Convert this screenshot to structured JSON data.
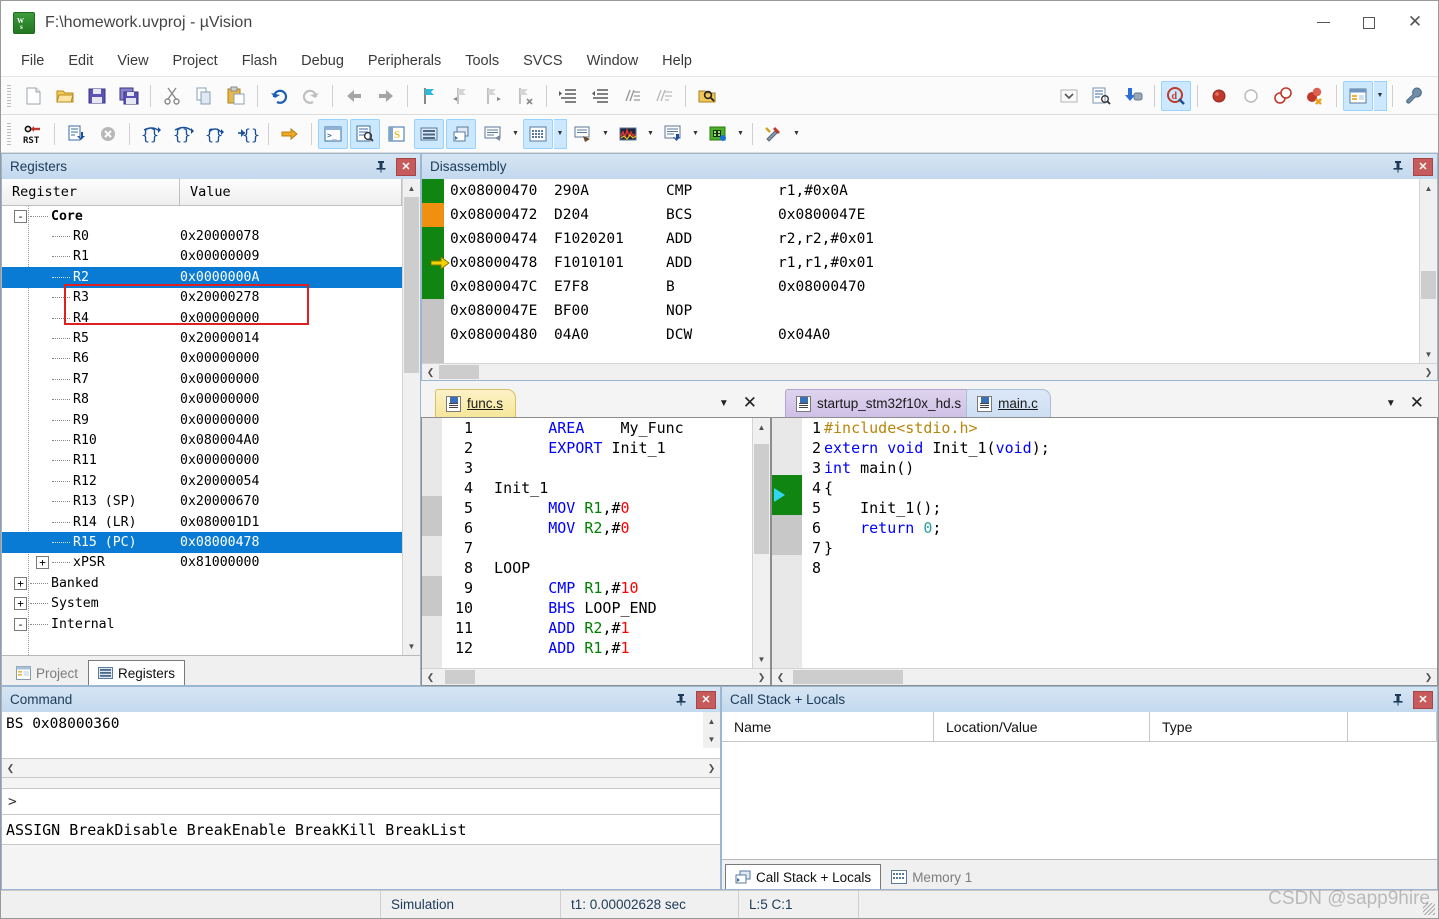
{
  "window": {
    "title": "F:\\homework.uvproj - µVision",
    "app_icon": "uvision-icon",
    "minimize_label": "Minimize",
    "maximize_label": "Maximize",
    "close_label": "Close"
  },
  "menubar": {
    "items": [
      {
        "label": "File"
      },
      {
        "label": "Edit"
      },
      {
        "label": "View"
      },
      {
        "label": "Project"
      },
      {
        "label": "Flash"
      },
      {
        "label": "Debug"
      },
      {
        "label": "Peripherals"
      },
      {
        "label": "Tools"
      },
      {
        "label": "SVCS"
      },
      {
        "label": "Window"
      },
      {
        "label": "Help"
      }
    ]
  },
  "toolbar_main": {
    "items": [
      {
        "icon": "new-file-icon",
        "name": "new-file"
      },
      {
        "icon": "open-folder-icon",
        "name": "open-file"
      },
      {
        "icon": "save-icon",
        "name": "save"
      },
      {
        "icon": "save-all-icon",
        "name": "save-all"
      },
      {
        "sep": true
      },
      {
        "icon": "cut-icon",
        "name": "cut"
      },
      {
        "icon": "copy-icon",
        "name": "copy"
      },
      {
        "icon": "paste-icon",
        "name": "paste"
      },
      {
        "sep": true
      },
      {
        "icon": "undo-icon",
        "name": "undo"
      },
      {
        "icon": "redo-icon",
        "name": "redo"
      },
      {
        "sep": true
      },
      {
        "icon": "back-arrow-icon",
        "name": "navigate-back"
      },
      {
        "icon": "forward-arrow-icon",
        "name": "navigate-forward"
      },
      {
        "sep": true
      },
      {
        "icon": "bookmark-icon",
        "name": "toggle-bookmark"
      },
      {
        "icon": "bookmark-prev-icon",
        "name": "previous-bookmark"
      },
      {
        "icon": "bookmark-next-icon",
        "name": "next-bookmark"
      },
      {
        "icon": "bookmark-clear-icon",
        "name": "clear-bookmarks"
      },
      {
        "sep": true
      },
      {
        "icon": "indent-right-icon",
        "name": "indent-right"
      },
      {
        "icon": "indent-left-icon",
        "name": "indent-left"
      },
      {
        "icon": "comment-icon",
        "name": "comment-selection"
      },
      {
        "icon": "uncomment-icon",
        "name": "uncomment-selection"
      },
      {
        "sep": true
      },
      {
        "icon": "find-in-files-icon",
        "name": "find-in-files"
      }
    ],
    "right_items": [
      {
        "icon": "chevron-down-icon",
        "name": "toolbar-overflow"
      },
      {
        "icon": "configure-icon",
        "name": "configure-target"
      },
      {
        "icon": "download-icon",
        "name": "download-to-flash"
      },
      {
        "sep": true
      },
      {
        "icon": "debug-session-icon",
        "name": "start-stop-debug-session",
        "active": true
      },
      {
        "sep": true
      },
      {
        "icon": "breakpoint-icon",
        "name": "insert-remove-breakpoint"
      },
      {
        "icon": "breakpoint-disable-icon",
        "name": "enable-disable-breakpoint"
      },
      {
        "icon": "breakpoint-disable-all-icon",
        "name": "disable-all-breakpoints"
      },
      {
        "icon": "breakpoint-kill-all-icon",
        "name": "kill-all-breakpoints"
      },
      {
        "sep": true
      },
      {
        "icon": "project-window-icon",
        "name": "project-windows",
        "active": true,
        "caret": true
      },
      {
        "sep": true
      },
      {
        "icon": "wrench-icon",
        "name": "configuration-wizard"
      }
    ]
  },
  "toolbar_debug": {
    "items": [
      {
        "icon": "reset-icon",
        "name": "reset-cpu",
        "label": "RST"
      },
      {
        "sep": true
      },
      {
        "icon": "run-icon",
        "name": "run"
      },
      {
        "icon": "stop-icon",
        "name": "stop"
      },
      {
        "sep": true
      },
      {
        "icon": "step-into-icon",
        "name": "step"
      },
      {
        "icon": "step-over-icon",
        "name": "step-over"
      },
      {
        "icon": "step-out-icon",
        "name": "step-out"
      },
      {
        "icon": "run-to-cursor-icon",
        "name": "run-to-cursor-line"
      },
      {
        "sep": true
      },
      {
        "icon": "show-next-statement-icon",
        "name": "show-next-statement"
      },
      {
        "sep": true
      },
      {
        "icon": "command-window-icon",
        "name": "command-window",
        "active": true
      },
      {
        "icon": "disassembly-window-icon",
        "name": "disassembly-window",
        "active": true
      },
      {
        "icon": "symbols-window-icon",
        "name": "symbol-window"
      },
      {
        "icon": "registers-window-icon",
        "name": "registers-window",
        "active": true
      },
      {
        "icon": "call-stack-icon",
        "name": "call-stack-window",
        "active": true
      },
      {
        "icon": "watch-window-icon",
        "name": "watch-windows",
        "caret": true
      },
      {
        "icon": "memory-window-icon",
        "name": "memory-windows",
        "active": true,
        "caret": true
      },
      {
        "icon": "serial-window-icon",
        "name": "serial-windows",
        "caret": true
      },
      {
        "icon": "analysis-window-icon",
        "name": "analysis-windows",
        "caret": true
      },
      {
        "icon": "trace-window-icon",
        "name": "trace-windows",
        "caret": true
      },
      {
        "icon": "system-viewer-icon",
        "name": "system-analyzer",
        "caret": true
      },
      {
        "sep": true
      },
      {
        "icon": "tools-icon",
        "name": "debug-tools",
        "caret": true
      }
    ]
  },
  "registers_panel": {
    "title": "Registers",
    "pin_icon": "pin-icon",
    "close_icon": "close-icon",
    "columns": [
      "Register",
      "Value"
    ],
    "rows": [
      {
        "name": "Core",
        "value": "",
        "depth": 0,
        "expander": "-",
        "bold": true,
        "selected": false
      },
      {
        "name": "R0",
        "value": "0x20000078",
        "depth": 1,
        "expander": "",
        "bold": false,
        "selected": false
      },
      {
        "name": "R1",
        "value": "0x00000009",
        "depth": 1,
        "expander": "",
        "bold": false,
        "selected": false
      },
      {
        "name": "R2",
        "value": "0x0000000A",
        "depth": 1,
        "expander": "",
        "bold": false,
        "selected": true
      },
      {
        "name": "R3",
        "value": "0x20000278",
        "depth": 1,
        "expander": "",
        "bold": false,
        "selected": false
      },
      {
        "name": "R4",
        "value": "0x00000000",
        "depth": 1,
        "expander": "",
        "bold": false,
        "selected": false
      },
      {
        "name": "R5",
        "value": "0x20000014",
        "depth": 1,
        "expander": "",
        "bold": false,
        "selected": false
      },
      {
        "name": "R6",
        "value": "0x00000000",
        "depth": 1,
        "expander": "",
        "bold": false,
        "selected": false
      },
      {
        "name": "R7",
        "value": "0x00000000",
        "depth": 1,
        "expander": "",
        "bold": false,
        "selected": false
      },
      {
        "name": "R8",
        "value": "0x00000000",
        "depth": 1,
        "expander": "",
        "bold": false,
        "selected": false
      },
      {
        "name": "R9",
        "value": "0x00000000",
        "depth": 1,
        "expander": "",
        "bold": false,
        "selected": false
      },
      {
        "name": "R10",
        "value": "0x080004A0",
        "depth": 1,
        "expander": "",
        "bold": false,
        "selected": false
      },
      {
        "name": "R11",
        "value": "0x00000000",
        "depth": 1,
        "expander": "",
        "bold": false,
        "selected": false
      },
      {
        "name": "R12",
        "value": "0x20000054",
        "depth": 1,
        "expander": "",
        "bold": false,
        "selected": false
      },
      {
        "name": "R13 (SP)",
        "value": "0x20000670",
        "depth": 1,
        "expander": "",
        "bold": false,
        "selected": false
      },
      {
        "name": "R14 (LR)",
        "value": "0x080001D1",
        "depth": 1,
        "expander": "",
        "bold": false,
        "selected": false
      },
      {
        "name": "R15 (PC)",
        "value": "0x08000478",
        "depth": 1,
        "expander": "",
        "bold": false,
        "selected": true
      },
      {
        "name": "xPSR",
        "value": "0x81000000",
        "depth": 1,
        "expander": "+",
        "bold": false,
        "selected": false
      },
      {
        "name": "Banked",
        "value": "",
        "depth": 0,
        "expander": "+",
        "bold": false,
        "selected": false
      },
      {
        "name": "System",
        "value": "",
        "depth": 0,
        "expander": "+",
        "bold": false,
        "selected": false
      },
      {
        "name": "Internal",
        "value": "",
        "depth": 0,
        "expander": "-",
        "bold": false,
        "selected": false
      }
    ],
    "highlight_annotation": "red-rectangle-around-R1-R2",
    "dock_tabs": [
      {
        "label": "Project",
        "icon": "project-icon",
        "active": false
      },
      {
        "label": "Registers",
        "icon": "registers-icon",
        "active": true
      }
    ]
  },
  "disassembly_panel": {
    "title": "Disassembly",
    "pin_icon": "pin-icon",
    "close_icon": "close-icon",
    "lines": [
      {
        "address": "0x08000470",
        "opcode": "290A",
        "mnemonic": "CMP",
        "operands": "r1,#0x0A",
        "marker": "green",
        "current": false
      },
      {
        "address": "0x08000472",
        "opcode": "D204",
        "mnemonic": "BCS",
        "operands": "0x0800047E",
        "marker": "orange",
        "current": false
      },
      {
        "address": "0x08000474",
        "opcode": "F1020201",
        "mnemonic": "ADD",
        "operands": "r2,r2,#0x01",
        "marker": "green",
        "current": false
      },
      {
        "address": "0x08000478",
        "opcode": "F1010101",
        "mnemonic": "ADD",
        "operands": "r1,r1,#0x01",
        "marker": "green",
        "current": true
      },
      {
        "address": "0x0800047C",
        "opcode": "E7F8",
        "mnemonic": "B",
        "operands": "0x08000470",
        "marker": "green",
        "current": false
      },
      {
        "address": "0x0800047E",
        "opcode": "BF00",
        "mnemonic": "NOP",
        "operands": "",
        "marker": "grey",
        "current": false
      },
      {
        "address": "0x08000480",
        "opcode": "04A0",
        "mnemonic": "DCW",
        "operands": "0x04A0",
        "marker": "grey",
        "current": false
      }
    ]
  },
  "editor_left": {
    "tabs": [
      {
        "label": "func.s",
        "active": true,
        "color": "yellow",
        "icon": "asm-file-icon"
      }
    ],
    "caret_icon": "chevron-down-icon",
    "close_icon": "close-icon",
    "lines": [
      {
        "n": "1",
        "tokens": [
          {
            "t": "        ",
            "c": ""
          },
          {
            "t": "AREA",
            "c": "kw"
          },
          {
            "t": "    ",
            "c": ""
          },
          {
            "t": "My_Func",
            "c": ""
          }
        ]
      },
      {
        "n": "2",
        "tokens": [
          {
            "t": "        ",
            "c": ""
          },
          {
            "t": "EXPORT",
            "c": "kw"
          },
          {
            "t": " Init_1",
            "c": ""
          }
        ]
      },
      {
        "n": "3",
        "tokens": [
          {
            "t": "",
            "c": ""
          }
        ]
      },
      {
        "n": "4",
        "tokens": [
          {
            "t": "  Init_1",
            "c": ""
          }
        ]
      },
      {
        "n": "5",
        "tokens": [
          {
            "t": "        ",
            "c": ""
          },
          {
            "t": "MOV",
            "c": "kw"
          },
          {
            "t": " ",
            "c": ""
          },
          {
            "t": "R1",
            "c": "reg"
          },
          {
            "t": ",#",
            "c": ""
          },
          {
            "t": "0",
            "c": "num"
          }
        ]
      },
      {
        "n": "6",
        "tokens": [
          {
            "t": "        ",
            "c": ""
          },
          {
            "t": "MOV",
            "c": "kw"
          },
          {
            "t": " ",
            "c": ""
          },
          {
            "t": "R2",
            "c": "reg"
          },
          {
            "t": ",#",
            "c": ""
          },
          {
            "t": "0",
            "c": "num"
          }
        ]
      },
      {
        "n": "7",
        "tokens": [
          {
            "t": "",
            "c": ""
          }
        ]
      },
      {
        "n": "8",
        "tokens": [
          {
            "t": "  LOOP",
            "c": ""
          }
        ]
      },
      {
        "n": "9",
        "tokens": [
          {
            "t": "        ",
            "c": ""
          },
          {
            "t": "CMP",
            "c": "kw"
          },
          {
            "t": " ",
            "c": ""
          },
          {
            "t": "R1",
            "c": "reg"
          },
          {
            "t": ",#",
            "c": ""
          },
          {
            "t": "10",
            "c": "num"
          }
        ]
      },
      {
        "n": "10",
        "tokens": [
          {
            "t": "        ",
            "c": ""
          },
          {
            "t": "BHS",
            "c": "kw"
          },
          {
            "t": " LOOP_END",
            "c": ""
          }
        ]
      },
      {
        "n": "11",
        "tokens": [
          {
            "t": "        ",
            "c": ""
          },
          {
            "t": "ADD",
            "c": "kw"
          },
          {
            "t": " ",
            "c": ""
          },
          {
            "t": "R2",
            "c": "reg"
          },
          {
            "t": ",#",
            "c": ""
          },
          {
            "t": "1",
            "c": "num"
          }
        ]
      },
      {
        "n": "12",
        "tokens": [
          {
            "t": "        ",
            "c": ""
          },
          {
            "t": "ADD",
            "c": "kw"
          },
          {
            "t": " ",
            "c": ""
          },
          {
            "t": "R1",
            "c": "reg"
          },
          {
            "t": ",#",
            "c": ""
          },
          {
            "t": "1",
            "c": "num"
          }
        ]
      }
    ]
  },
  "editor_right": {
    "tabs": [
      {
        "label": "startup_stm32f10x_hd.s",
        "active": false,
        "color": "purple",
        "icon": "asm-file-icon"
      },
      {
        "label": "main.c",
        "active": true,
        "color": "blue",
        "icon": "c-file-icon"
      }
    ],
    "caret_icon": "chevron-down-icon",
    "close_icon": "close-icon",
    "lines": [
      {
        "n": "1",
        "tokens": [
          {
            "t": "#include<stdio.h>",
            "c": "str"
          }
        ]
      },
      {
        "n": "2",
        "tokens": [
          {
            "t": "extern void",
            "c": "kw"
          },
          {
            "t": " Init_1(",
            "c": ""
          },
          {
            "t": "void",
            "c": "kw"
          },
          {
            "t": ");",
            "c": ""
          }
        ]
      },
      {
        "n": "3",
        "tokens": [
          {
            "t": "int",
            "c": "kw"
          },
          {
            "t": " main()",
            "c": ""
          }
        ]
      },
      {
        "n": "4",
        "tokens": [
          {
            "t": "{",
            "c": ""
          }
        ]
      },
      {
        "n": "5",
        "tokens": [
          {
            "t": "    Init_1();",
            "c": ""
          }
        ]
      },
      {
        "n": "6",
        "tokens": [
          {
            "t": "    ",
            "c": ""
          },
          {
            "t": "return",
            "c": "kw"
          },
          {
            "t": " ",
            "c": ""
          },
          {
            "t": "0",
            "c": "cy"
          },
          {
            "t": ";",
            "c": ""
          }
        ]
      },
      {
        "n": "7",
        "tokens": [
          {
            "t": "}",
            "c": ""
          }
        ]
      },
      {
        "n": "8",
        "tokens": [
          {
            "t": "",
            "c": ""
          }
        ]
      }
    ]
  },
  "command_panel": {
    "title": "Command",
    "pin_icon": "pin-icon",
    "close_icon": "close-icon",
    "output": "BS  0x08000360",
    "prompt": ">",
    "input_value": "",
    "help_line": "ASSIGN BreakDisable BreakEnable BreakKill BreakList"
  },
  "call_stack_panel": {
    "title": "Call Stack + Locals",
    "pin_icon": "pin-icon",
    "close_icon": "close-icon",
    "columns": [
      "Name",
      "Location/Value",
      "Type"
    ],
    "rows": [],
    "tabs": [
      {
        "label": "Call Stack + Locals",
        "icon": "call-stack-icon",
        "active": true
      },
      {
        "label": "Memory 1",
        "icon": "memory-icon",
        "active": false
      }
    ]
  },
  "statusbar": {
    "cells": [
      "",
      "Simulation",
      "t1: 0.00002628 sec",
      "L:5 C:1"
    ]
  },
  "watermark": "CSDN @sapp9hire",
  "colors": {
    "selection_blue": "#0a7bd4",
    "annotation_red": "#e02020",
    "gutter_green": "#118511",
    "gutter_orange": "#f09010",
    "pc_arrow_yellow": "#f2d200",
    "panel_header": "#c3d9ee",
    "keyword_blue": "#0000ff",
    "register_green": "#008000",
    "number_red": "#ff0000"
  }
}
